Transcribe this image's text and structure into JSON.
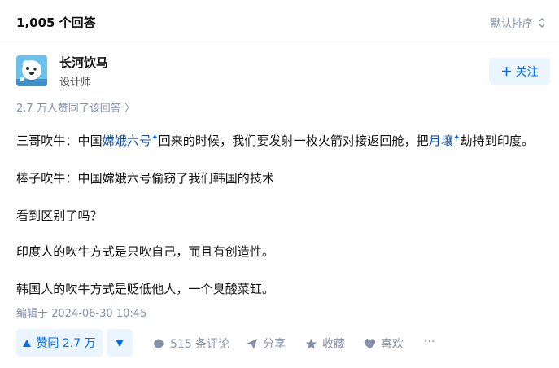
{
  "header": {
    "answer_count": "1,005 个回答",
    "sort_label": "默认排序"
  },
  "author": {
    "name": "长河饮马",
    "title": "设计师",
    "follow_label": "关注"
  },
  "upvote_summary": "2.7 万人赞同了该回答 〉",
  "content": {
    "p1": {
      "before": "三哥吹牛：中国",
      "link1": "嫦娥六号",
      "middle": "回来的时候，我们要发射一枚火箭对接返回舱，把",
      "link2": "月壤",
      "after": "劫持到印度。"
    },
    "p2": "棒子吹牛：中国嫦娥六号偷窃了我们韩国的技术",
    "p3": "看到区别了吗？",
    "p4": "印度人的吹牛方式是只吹自己，而且有创造性。",
    "p5": "韩国人的吹牛方式是贬低他人，一个臭酸菜缸。"
  },
  "edit_time": "编辑于 2024-06-30 10:45",
  "actions": {
    "upvote": "赞同 2.7 万",
    "comments": "515 条评论",
    "share": "分享",
    "collect": "收藏",
    "like": "喜欢",
    "more": "···"
  },
  "colors": {
    "brand_blue": "#056de8",
    "muted": "#8590a6",
    "button_bg": "#ebf5ff",
    "link": "#175199"
  }
}
